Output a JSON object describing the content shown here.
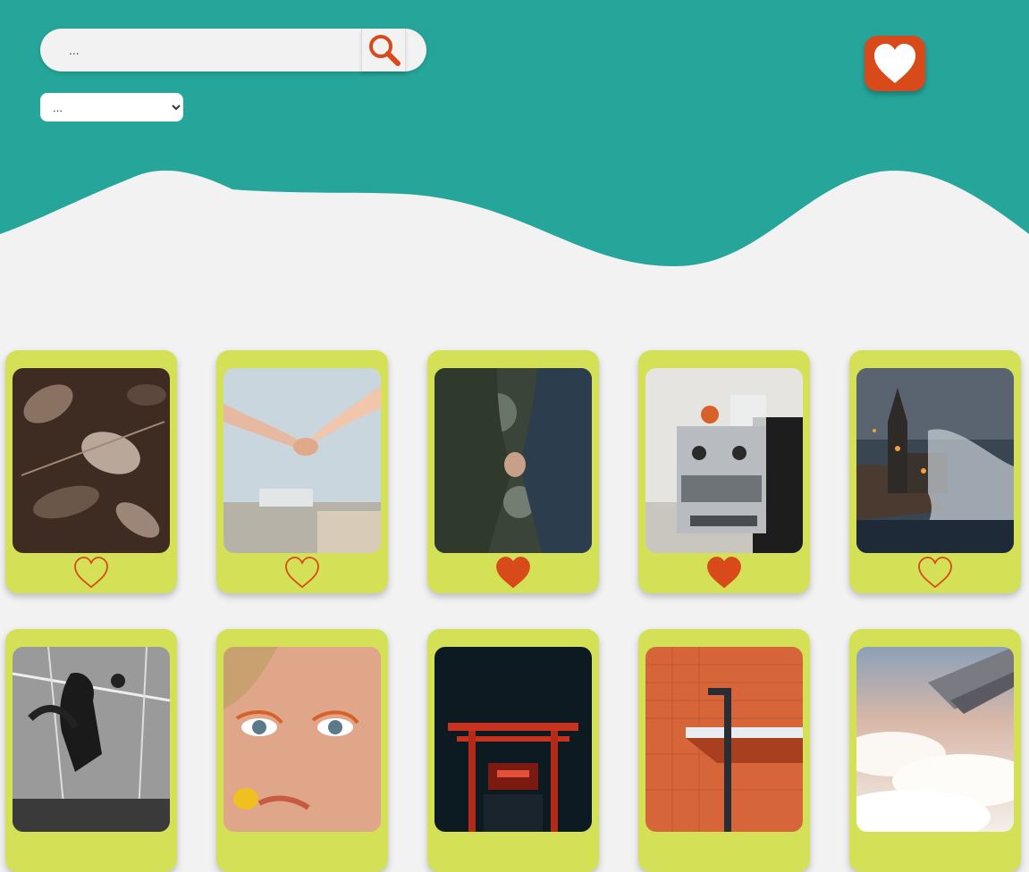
{
  "colors": {
    "header": "#26a69a",
    "card": "#d4e157",
    "accent": "#d84a1a",
    "background": "#f2f2f2"
  },
  "search": {
    "placeholder": "...",
    "button_icon": "search-icon"
  },
  "filter": {
    "selected": "..."
  },
  "favorites": {
    "icon": "heart-icon"
  },
  "gallery": {
    "cards": [
      {
        "image": "frost-covered-leaves-photo",
        "liked": false
      },
      {
        "image": "holding-hands-sky-photo",
        "liked": false
      },
      {
        "image": "holding-hands-forest-photo",
        "liked": true
      },
      {
        "image": "espresso-machine-photo",
        "liked": true
      },
      {
        "image": "coastal-church-night-photo",
        "liked": false
      },
      {
        "image": "dancer-monochrome-photo",
        "liked": false
      },
      {
        "image": "woman-orange-makeup-photo",
        "liked": false
      },
      {
        "image": "red-torii-gate-night-photo",
        "liked": false
      },
      {
        "image": "orange-tiled-wall-lamp-photo",
        "liked": false
      },
      {
        "image": "airplane-wing-clouds-photo",
        "liked": false
      }
    ]
  }
}
